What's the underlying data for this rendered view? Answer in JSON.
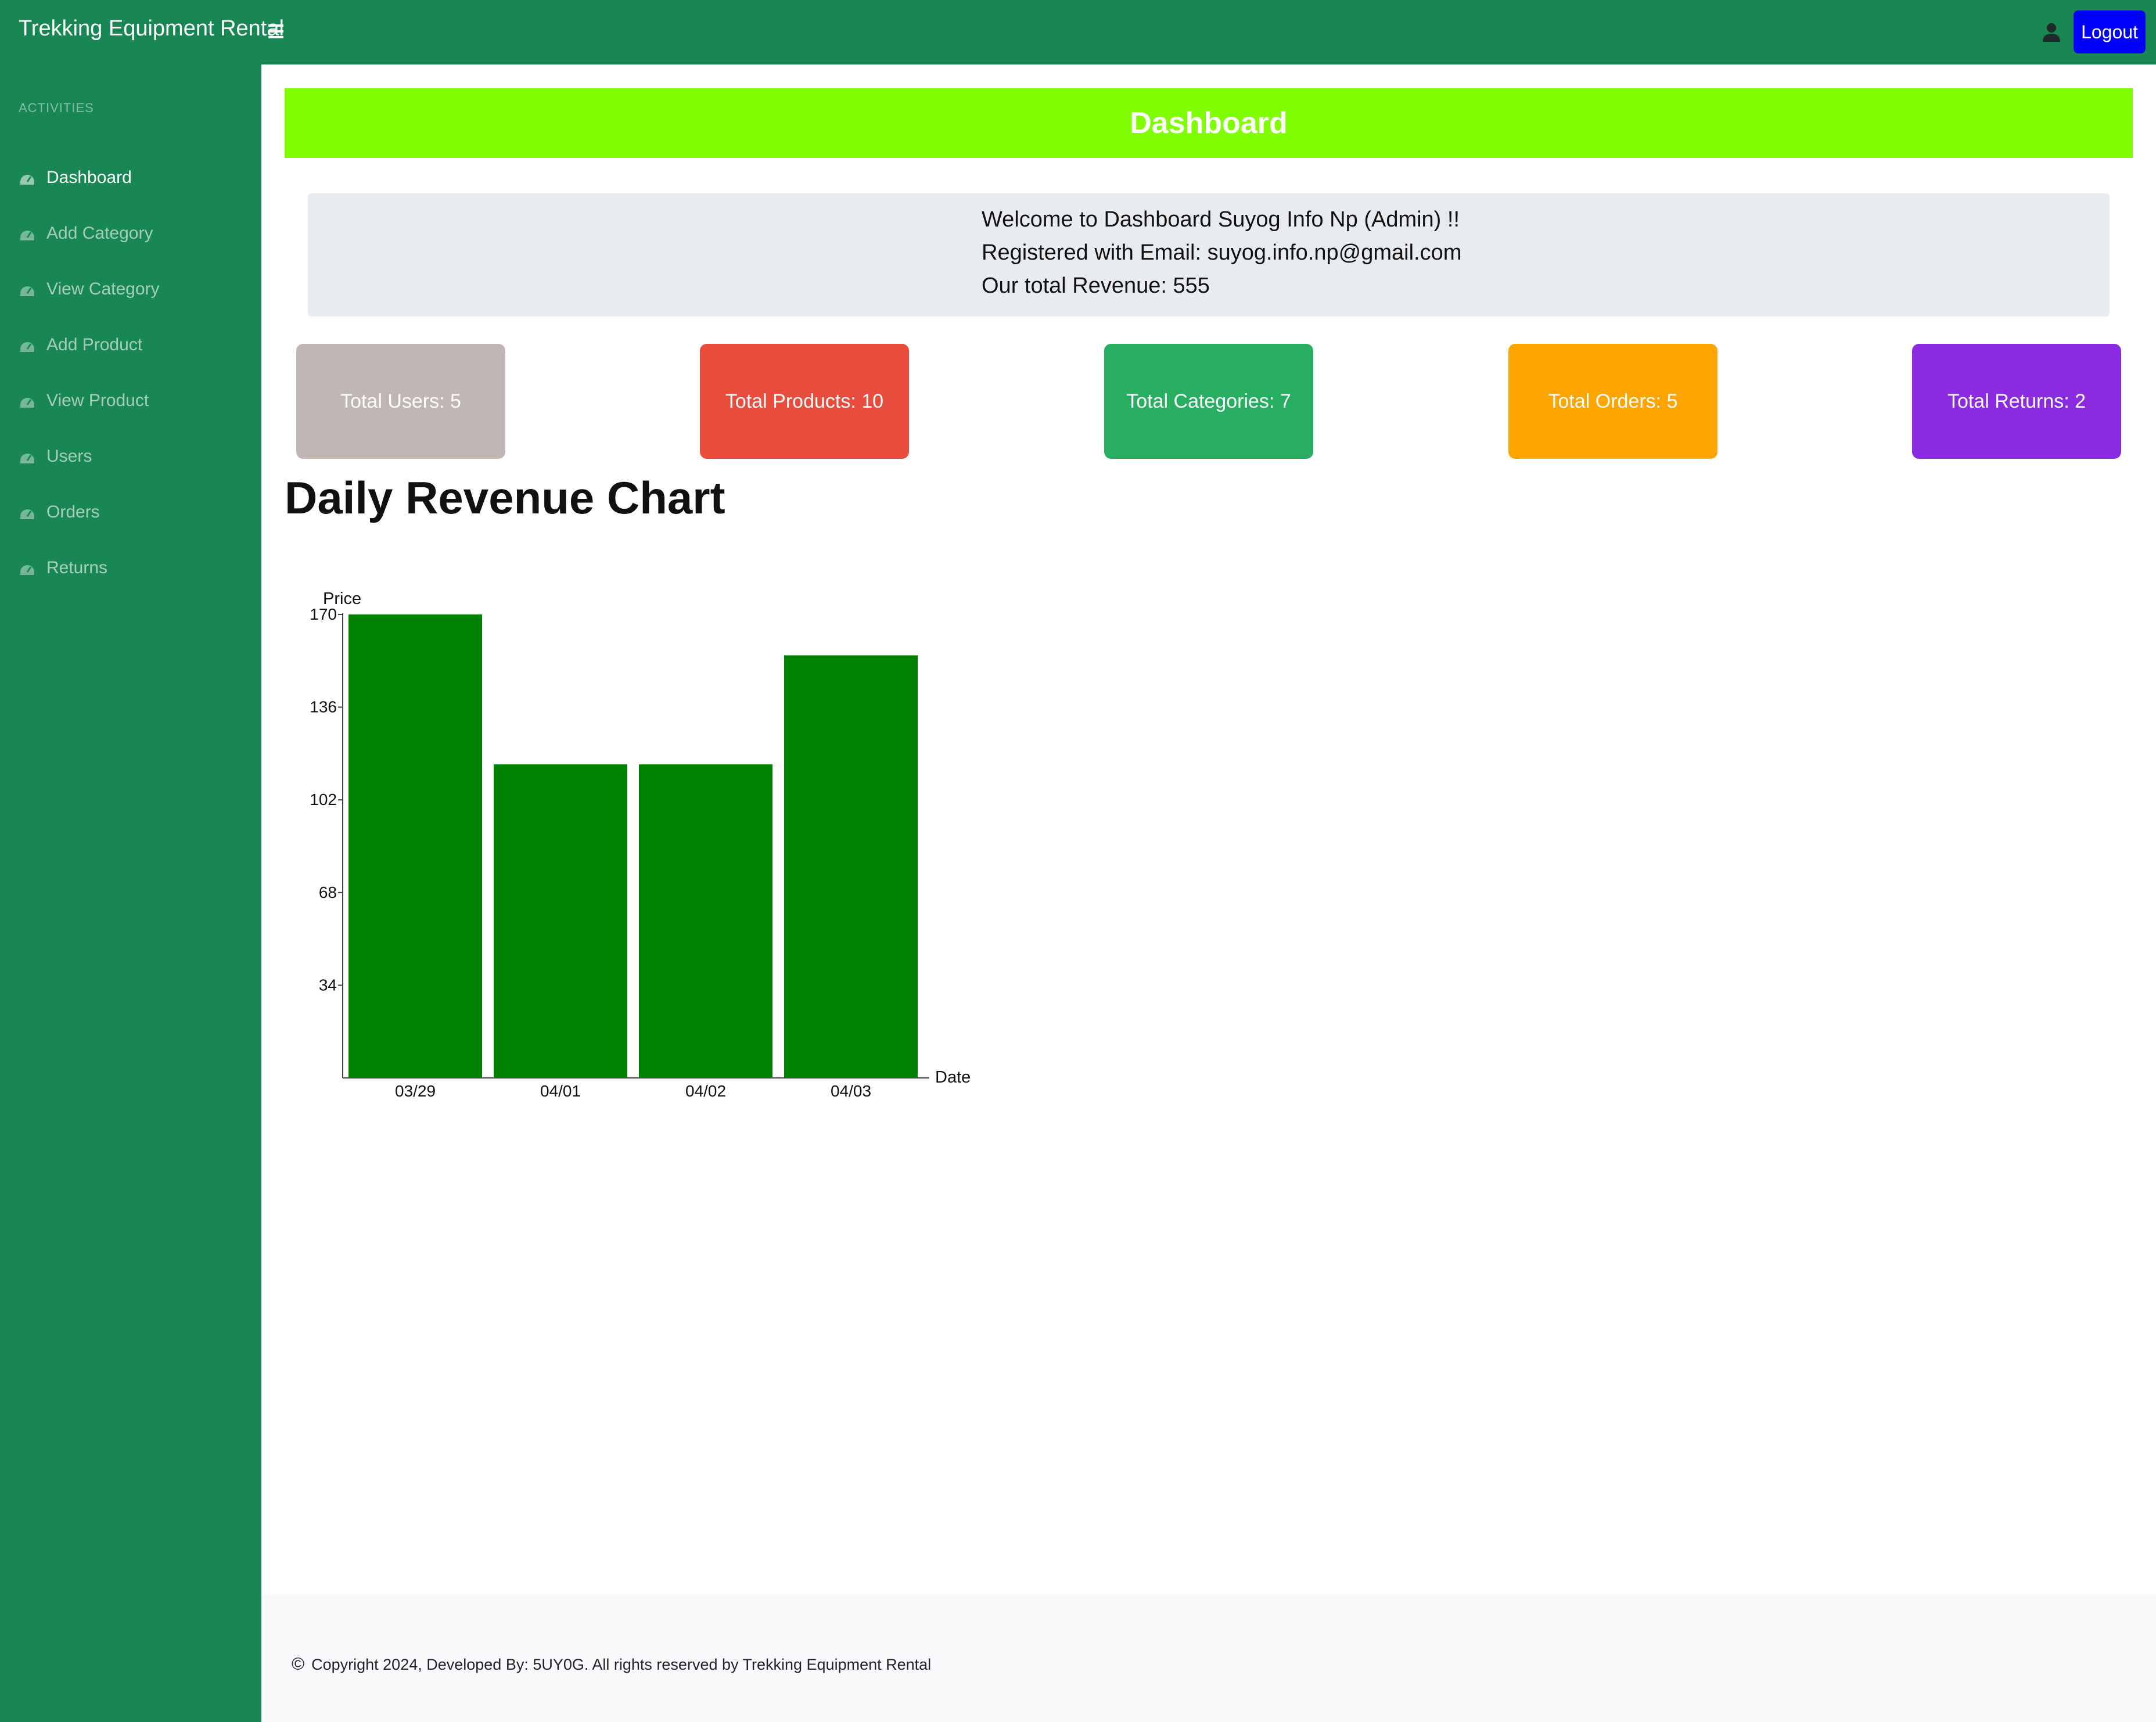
{
  "header": {
    "brand": "Trekking Equipment Rental",
    "toggle_icon": "hamburger-icon",
    "user_icon": "user-icon",
    "logout_label": "Logout",
    "logout_color": "#0000ff",
    "bar_color": "#198754"
  },
  "sidebar": {
    "heading": "ACTIVITIES",
    "items": [
      {
        "label": "Dashboard",
        "icon": "dashboard-icon",
        "active": true
      },
      {
        "label": "Add Category",
        "icon": "dashboard-icon"
      },
      {
        "label": "View Category",
        "icon": "dashboard-icon"
      },
      {
        "label": "Add Product",
        "icon": "dashboard-icon"
      },
      {
        "label": "View Product",
        "icon": "dashboard-icon"
      },
      {
        "label": "Users",
        "icon": "dashboard-icon"
      },
      {
        "label": "Orders",
        "icon": "dashboard-icon"
      },
      {
        "label": "Returns",
        "icon": "dashboard-icon"
      }
    ]
  },
  "main": {
    "banner_title": "Dashboard",
    "banner_color": "#80ff00",
    "welcome": {
      "line1": "Welcome to Dashboard Suyog Info Np (Admin) !!",
      "line2": "Registered with Email: suyog.info.np@gmail.com",
      "line3": "Our total Revenue: 555"
    },
    "stats": [
      {
        "label": "Total Users: 5",
        "color": "#c0b7b5"
      },
      {
        "label": "Total Products: 10",
        "color": "#e74c3c"
      },
      {
        "label": "Total Categories: 7",
        "color": "#27ae60"
      },
      {
        "label": "Total Orders: 5",
        "color": "#ffa500"
      },
      {
        "label": "Total Returns: 2",
        "color": "#8a2be2"
      }
    ],
    "chart_heading": "Daily Revenue Chart"
  },
  "chart_data": {
    "type": "bar",
    "categories": [
      "03/29",
      "04/01",
      "04/02",
      "04/03"
    ],
    "values": [
      170,
      115,
      115,
      155
    ],
    "xlabel": "Date",
    "ylabel": "Price",
    "ylim": [
      0,
      170
    ],
    "yticks": [
      34,
      68,
      102,
      136,
      170
    ],
    "bar_color": "#008000",
    "grid": false
  },
  "footer": {
    "copyright_icon": "copyright-icon",
    "text": "Copyright 2024, Developed By: 5UY0G. All rights reserved by Trekking Equipment Rental"
  }
}
